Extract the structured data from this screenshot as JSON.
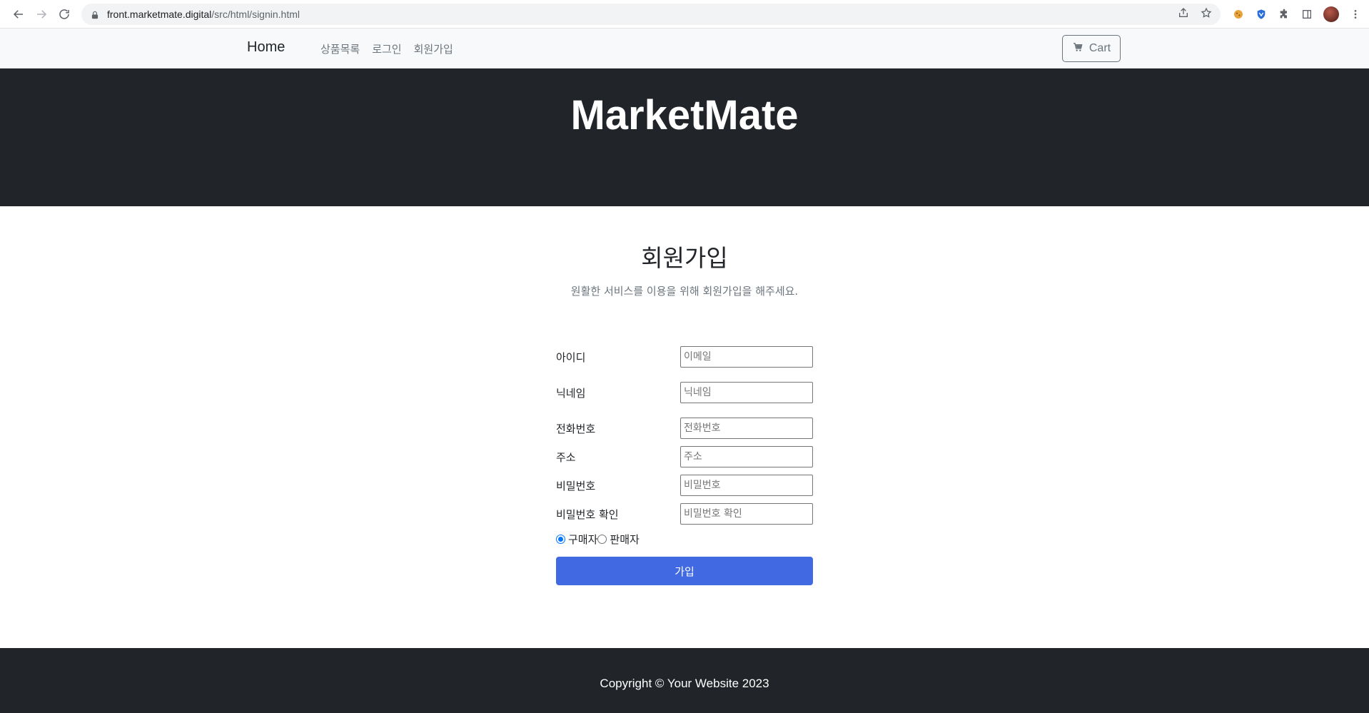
{
  "browser": {
    "url_host": "front.marketmate.digital",
    "url_path": "/src/html/signin.html"
  },
  "navbar": {
    "brand": "Home",
    "links": [
      "상품목록",
      "로그인",
      "회원가입"
    ],
    "cart_label": "Cart"
  },
  "header": {
    "title": "MarketMate"
  },
  "signup": {
    "title": "회원가입",
    "subtitle": "원활한 서비스를 이용을 위해 회원가입을 해주세요.",
    "fields": [
      {
        "label": "아이디",
        "placeholder": "이메일"
      },
      {
        "label": "닉네임",
        "placeholder": "닉네임"
      },
      {
        "label": "전화번호",
        "placeholder": "전화번호"
      },
      {
        "label": "주소",
        "placeholder": "주소"
      },
      {
        "label": "비밀번호",
        "placeholder": "비밀번호"
      },
      {
        "label": "비밀번호 확인",
        "placeholder": "비밀번호 확인"
      }
    ],
    "roles": [
      {
        "label": "구매자",
        "checked": true
      },
      {
        "label": "판매자",
        "checked": false
      }
    ],
    "submit_label": "가입"
  },
  "footer": {
    "copyright": "Copyright © Your Website 2023"
  },
  "colors": {
    "dark": "#212529",
    "primary_button": "#4169e1"
  }
}
